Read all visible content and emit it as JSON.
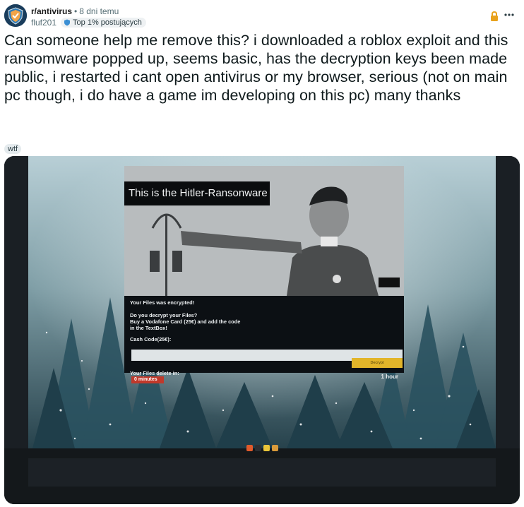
{
  "post": {
    "subreddit": "r/antivirus",
    "separator": "•",
    "time_ago": "8 dni temu",
    "author": "fluf201",
    "author_badge": "Top 1% postujących",
    "title": "Can someone help me remove this? i downloaded a roblox exploit and this ransomware popped up, seems basic, has the decryption keys been made public, i restarted i cant open antivirus or my browser, serious (not on main pc though, i do have a game im developing on this pc) many thanks",
    "flair": "wtf",
    "icons": {
      "lock": "lock-icon",
      "more": "more-options-icon",
      "badge": "shield-icon"
    }
  },
  "ransomware_window": {
    "title": "This is the Hitler-Ransonware",
    "encrypted_msg": "Your Files was encrypted!",
    "question": "Do you decrypt your Files?",
    "instructions_line1": "Buy a Vodafone Card (25€) and add the code",
    "instructions_line2": "in the TextBox!",
    "cash_label": "Cash Code(25€):",
    "decrypt_button": "Decrypt",
    "delete_label": "Your Files delete in:",
    "timer_left": "0 minutes",
    "timer_right": "1 hour"
  },
  "colors": {
    "accent_gold": "#e2b52a",
    "timer_red": "#c0392b",
    "subreddit_avatar": "#1a3d5c"
  }
}
